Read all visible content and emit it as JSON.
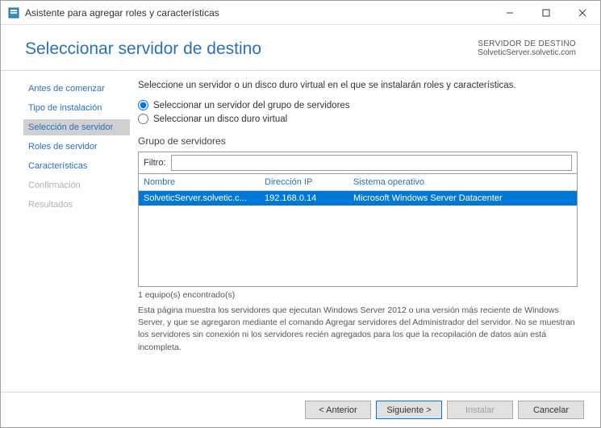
{
  "titlebar": {
    "title": "Asistente para agregar roles y características"
  },
  "header": {
    "page_title": "Seleccionar servidor de destino",
    "dest_label": "SERVIDOR DE DESTINO",
    "dest_server": "SolveticServer.solvetic.com"
  },
  "sidebar": {
    "steps": [
      {
        "label": "Antes de comenzar",
        "state": "done"
      },
      {
        "label": "Tipo de instalación",
        "state": "done"
      },
      {
        "label": "Selección de servidor",
        "state": "active"
      },
      {
        "label": "Roles de servidor",
        "state": "done"
      },
      {
        "label": "Características",
        "state": "done"
      },
      {
        "label": "Confirmación",
        "state": "pending"
      },
      {
        "label": "Resultados",
        "state": "pending"
      }
    ]
  },
  "content": {
    "instruction": "Seleccione un servidor o un disco duro virtual en el que se instalarán roles y características.",
    "radio1": "Seleccionar un servidor del grupo de servidores",
    "radio2": "Seleccionar un disco duro virtual",
    "group_label": "Grupo de servidores",
    "filter_label": "Filtro:",
    "columns": {
      "name": "Nombre",
      "ip": "Dirección IP",
      "os": "Sistema operativo"
    },
    "rows": [
      {
        "name": "SolveticServer.solvetic.c...",
        "ip": "192.168.0.14",
        "os": "Microsoft Windows Server Datacenter"
      }
    ],
    "found": "1 equipo(s) encontrado(s)",
    "footnote": "Esta página muestra los servidores que ejecutan Windows Server 2012 o una versión más reciente de Windows Server, y que se agregaron mediante el comando Agregar servidores del Administrador del servidor. No se muestran los servidores sin conexión ni los servidores recién agregados para los que la recopilación de datos aún está incompleta."
  },
  "footer": {
    "prev": "< Anterior",
    "next": "Siguiente >",
    "install": "Instalar",
    "cancel": "Cancelar"
  }
}
